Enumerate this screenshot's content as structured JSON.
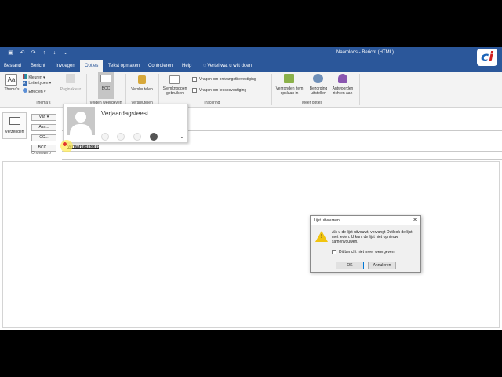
{
  "window": {
    "title": "Naamloos  -  Bericht (HTML)",
    "quick_access": [
      "save-icon",
      "undo-icon",
      "redo-icon",
      "up-icon",
      "down-icon",
      "customize-icon"
    ]
  },
  "tabs": [
    "Bestand",
    "Bericht",
    "Invoegen",
    "Opties",
    "Tekst opmaken",
    "Controleren",
    "Help"
  ],
  "active_tab": "Opties",
  "tell_me": "Vertel wat u wilt doen",
  "ribbon": {
    "themes": {
      "themes_label": "Thema's",
      "colors": "Kleuren",
      "fonts": "Lettertypen",
      "effects": "Effecten",
      "page_color": "Paginakleur",
      "group_label": "Thema's"
    },
    "fields": {
      "bcc": "BCC",
      "group_label": "Velden weergeven"
    },
    "encrypt": {
      "label": "Versleutelen",
      "group_label": "Versleutelen"
    },
    "tracking": {
      "voting": "Stemknoppen gebruiken",
      "request_delivery": "Vragen om ontvangstbevestiging",
      "request_read": "Vragen om leesbevestiging",
      "group_label": "Tracering"
    },
    "more": {
      "save_sent": "Verzonden item opslaan in",
      "delay": "Bezorging uitstellen",
      "direct_replies": "Antwoorden richten aan",
      "group_label": "Meer opties"
    }
  },
  "compose": {
    "send": "Verzenden",
    "from": "Van",
    "to": "Aan...",
    "cc": "CC...",
    "bcc": "BCC...",
    "subject": "Onderwerp",
    "bcc_value": "Verjaardagsfeest"
  },
  "contact_card": {
    "name": "Verjaardagsfeest"
  },
  "dialog": {
    "title": "Lijst uitvouwen",
    "message": "Als u de lijst uitvouwt, vervangt Outlook de lijst met leden. U kunt de lijst niet opnieuw samenvouwen.",
    "checkbox": "Dit bericht niet meer weergeven",
    "ok": "OK",
    "cancel": "Annuleren"
  },
  "colors": {
    "accent": "#2b579a",
    "ribbon": "#f3f3f3",
    "warning": "#f1c40f"
  }
}
